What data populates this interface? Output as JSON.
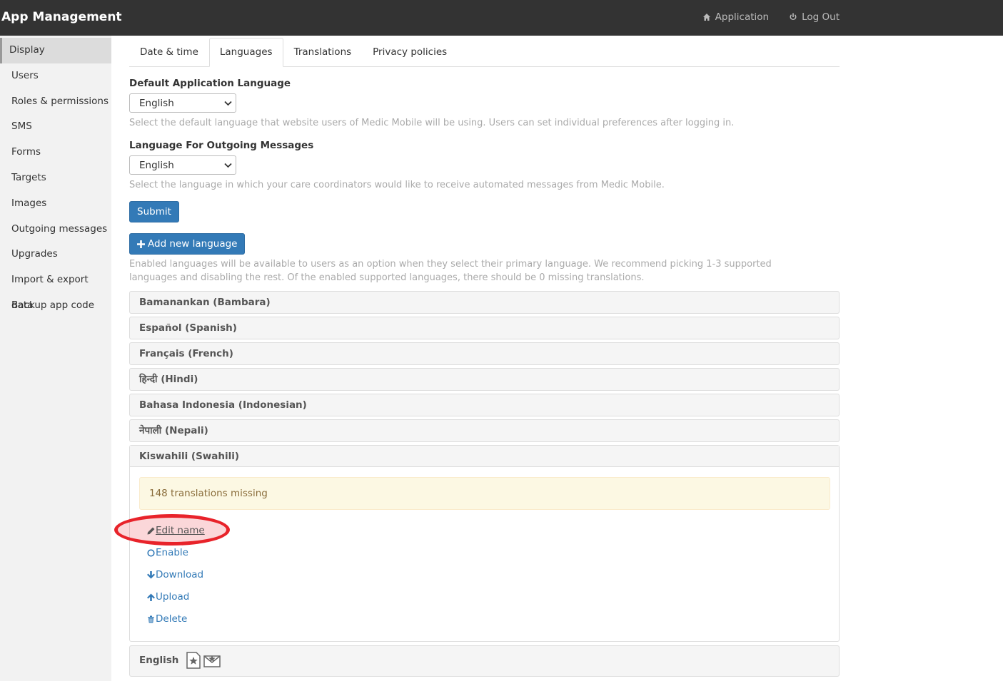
{
  "app": {
    "title": "App Management"
  },
  "nav": {
    "application": "Application",
    "logout": "Log Out"
  },
  "sidebar": {
    "items": [
      {
        "label": "Display",
        "active": true
      },
      {
        "label": "Users"
      },
      {
        "label": "Roles & permissions"
      },
      {
        "label": "SMS"
      },
      {
        "label": "Forms"
      },
      {
        "label": "Targets"
      },
      {
        "label": "Images"
      },
      {
        "label": "Outgoing messages"
      },
      {
        "label": "Upgrades"
      },
      {
        "label": "Import & export data"
      },
      {
        "label": "Backup app code"
      }
    ]
  },
  "tabs": [
    {
      "label": "Date & time"
    },
    {
      "label": "Languages",
      "active": true
    },
    {
      "label": "Translations"
    },
    {
      "label": "Privacy policies"
    }
  ],
  "default_lang": {
    "label": "Default Application Language",
    "value": "English",
    "help": "Select the default language that website users of Medic Mobile will be using. Users can set individual preferences after logging in."
  },
  "outgoing_lang": {
    "label": "Language For Outgoing Messages",
    "value": "English",
    "help": "Select the language in which your care coordinators would like to receive automated messages from Medic Mobile."
  },
  "submit_label": "Submit",
  "add_language_label": "Add new language",
  "languages_help": "Enabled languages will be available to users as an option when they select their primary language. We recommend picking 1-3 supported languages and disabling the rest. Of the enabled supported languages, there should be 0 missing translations.",
  "languages": [
    {
      "name": "Bamanankan (Bambara)"
    },
    {
      "name": "Español (Spanish)"
    },
    {
      "name": "Français (French)"
    },
    {
      "name": "हिन्दी (Hindi)"
    },
    {
      "name": "Bahasa Indonesia (Indonesian)"
    },
    {
      "name": "नेपाली (Nepali)"
    },
    {
      "name": "Kiswahili (Swahili)",
      "open": true
    },
    {
      "name": "English"
    }
  ],
  "swahili": {
    "missing": "148 translations missing",
    "actions": {
      "edit": "Edit name",
      "enable": "Enable",
      "download": "Download",
      "upload": "Upload",
      "delete": "Delete"
    }
  },
  "icons": {
    "home": "home-icon",
    "power": "power-icon",
    "chevron": "chevron-down-icon",
    "plus": "plus-icon",
    "pencil": "pencil-icon",
    "circle": "circle-icon",
    "arrow_down": "arrow-down-icon",
    "arrow_up": "arrow-up-icon",
    "trash": "trash-icon",
    "default_app": "default-app-language-icon",
    "default_msg": "default-message-language-icon"
  },
  "colors": {
    "primary": "#337ab7",
    "navbar": "#333333",
    "alert_bg": "#fcf8e3",
    "alert_text": "#8a6d3b",
    "highlight": "#e8232a"
  }
}
